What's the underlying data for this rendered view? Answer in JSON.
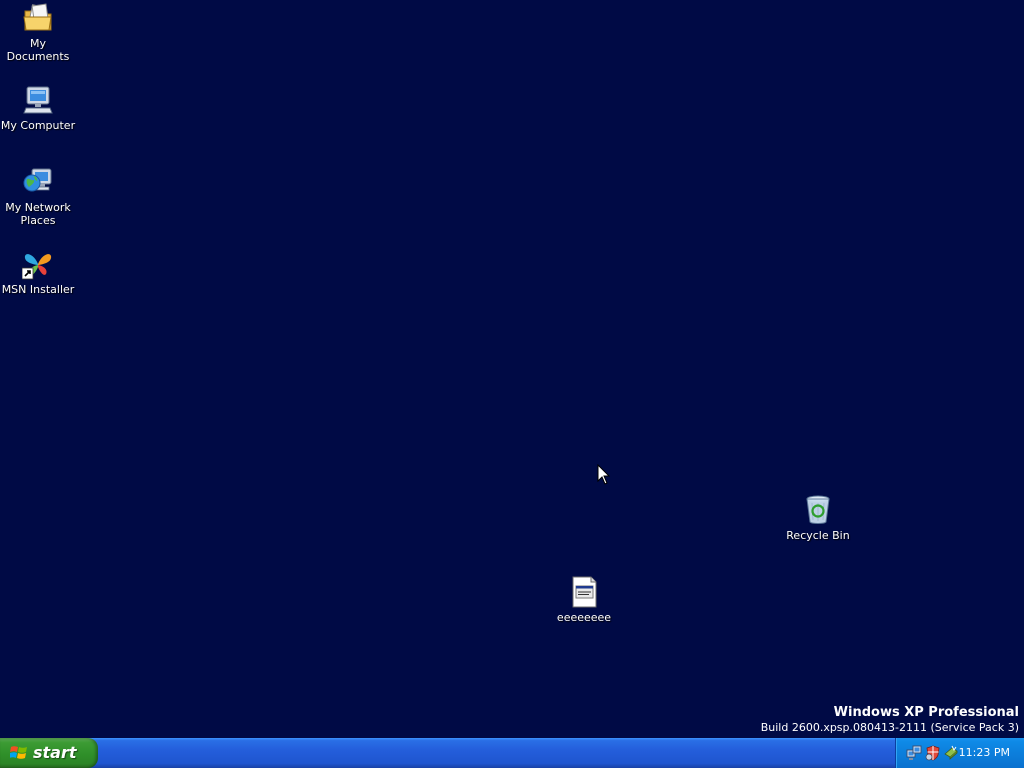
{
  "desktop": {
    "background": "#000a45",
    "icons": [
      {
        "label": "My Documents",
        "icon": "my-documents-icon"
      },
      {
        "label": "My Computer",
        "icon": "my-computer-icon"
      },
      {
        "label": "My Network Places",
        "icon": "network-places-icon"
      },
      {
        "label": "MSN Installer",
        "icon": "msn-butterfly-icon"
      },
      {
        "label": "Recycle Bin",
        "icon": "recycle-bin-icon"
      },
      {
        "label": "eeeeeeee",
        "icon": "text-file-icon"
      }
    ],
    "watermark": {
      "title": "Windows XP Professional",
      "build": "Build 2600.xpsp.080413-2111 (Service Pack 3)"
    }
  },
  "taskbar": {
    "start_label": "start",
    "tray": {
      "icons": [
        "network-connections-icon",
        "firewall-shield-icon",
        "safely-remove-hardware-icon"
      ],
      "clock": "11:23 PM"
    }
  }
}
